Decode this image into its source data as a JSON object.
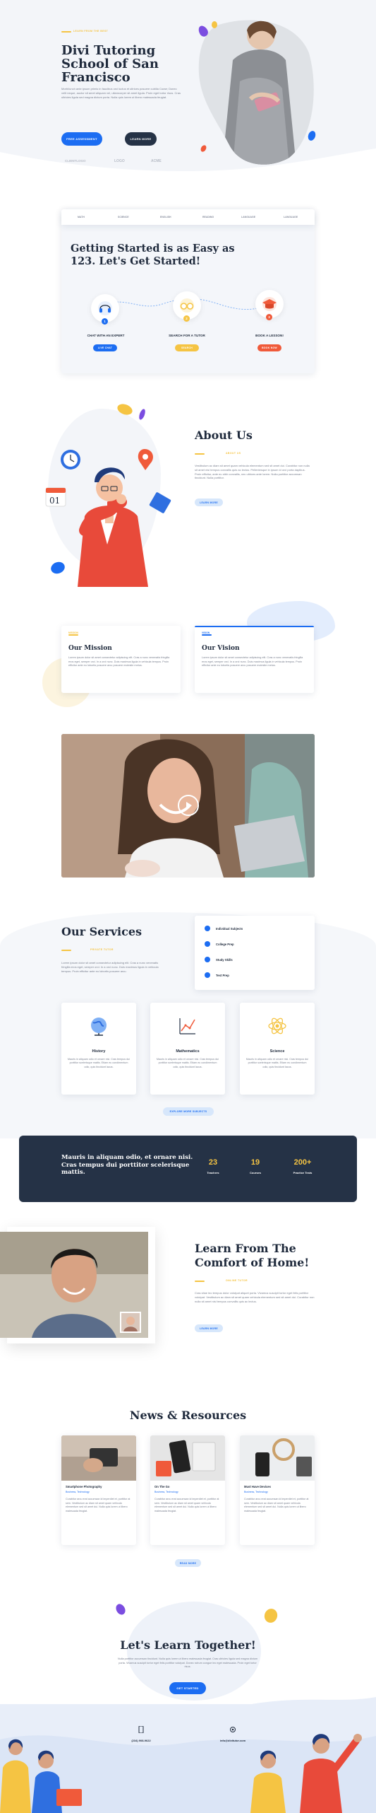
{
  "colors": {
    "blue": "#1c6df2",
    "yellow": "#f5c443",
    "red": "#f05a3a",
    "purple": "#7b4de0",
    "navy": "#253246",
    "bg": "#f3f5f9"
  },
  "hero": {
    "eyebrow": "LEARN FROM THE BEST",
    "title_line1": "Divi Tutoring",
    "title_line2": "School of San",
    "title_line3": "Francisco",
    "text": "Morbi/unch ante ipsum primis in faucibus orci luctus et ultrices posuere cubilia Curae; Donec velit neque, auctor sit amet aliquam vel, ullamcorper sit amet ligula. Proin eget tortor risus. Cras ultricies ligula sed magna dictum porta. Nulla quis lorem ut libero malesuada feugiat.",
    "btn_primary": "FREE ASSESSMENT",
    "btn_secondary": "LEARN MORE",
    "logos": [
      "CLIENTLOGO",
      "LOGO",
      "ACME"
    ]
  },
  "tabs": [
    "MATH",
    "SCIENCE",
    "ENGLISH",
    "READING",
    "LANGUAGE",
    "LANGUAGE"
  ],
  "steps_section": {
    "title_line1": "Getting Started is as Easy as",
    "title_line2": "123. Let's Get Started!",
    "steps": [
      {
        "num": "1",
        "title": "CHAT WITH AN EXPERT",
        "btn": "LIVE CHAT",
        "icon": "headset-icon"
      },
      {
        "num": "2",
        "title": "SEARCH FOR A TUTOR",
        "btn": "SEARCH",
        "icon": "glasses-icon"
      },
      {
        "num": "3",
        "title": "BOOK A LESSON!",
        "btn": "BOOK NOW",
        "icon": "graduation-cap-icon"
      }
    ]
  },
  "about": {
    "title": "About Us",
    "eyebrow": "ABOUT US",
    "text": "Vestibulum ac diam sit amet quam vehicula elementum sed sit amet dui. Curabitur non nulla sit amet nisl tempus convallis quis ac lectus. Pellentesque in ipsum id orci porta dapibus. Proin efficitur, ante eu nibh convallis, nec ultrices ante lorem. Nulla porttitor accumsan tincidunt. Nulla porttitor.",
    "btn": "LEARN MORE",
    "calendar_day": "01"
  },
  "mission": {
    "eyebrow": "MISSION",
    "title": "Our Mission",
    "text": "Lorem ipsum dolor sit amet consectetur adipiscing elit. Cras a nunc venenatis fringilla eros eget, semper orci. In a orci nunc. Duis maximus ligula in vehicula tempus. Proin efficitur ante eu lobortis posuere arcu posuere molestie metus."
  },
  "vision": {
    "eyebrow": "VISION",
    "title": "Our Vision",
    "text": "Lorem ipsum dolor sit amet consectetur adipiscing elit. Cras a nunc venenatis fringilla eros eget, semper orci. In a orci nunc. Duis maximus ligula in vehicula tempus. Proin efficitur ante eu lobortis posuere arcu posuere molestie metus."
  },
  "services": {
    "title": "Our Services",
    "eyebrow": "PRIVATE TUTOR",
    "text": "Lorem ipsum dolor sit amet consectetur adipiscing elit. Cras a nunc venenatis fringilla eros eget, semper orci. In a orci nunc. Duis maximus ligula in vehicula tempus. Proin efficitur ante eu lobortis posuere arcu.",
    "list": [
      "Individual Subjects",
      "College Prep",
      "Study Skills",
      "Test Prep"
    ],
    "cards": [
      {
        "title": "History",
        "text": "Mauris in aliquam odio et ornare nisi. Cras tempus dui porttitor scelerisque mattis. Etiam eu condimentum odio, quis tincidunt lacus.",
        "icon": "globe-icon"
      },
      {
        "title": "Mathematics",
        "text": "Mauris in aliquam odio et ornare nisi. Cras tempus dui porttitor scelerisque mattis. Etiam eu condimentum odio, quis tincidunt lacus.",
        "icon": "chart-icon"
      },
      {
        "title": "Science",
        "text": "Mauris in aliquam odio et ornare nisi. Cras tempus dui porttitor scelerisque mattis. Etiam eu condimentum odio, quis tincidunt lacus.",
        "icon": "atom-icon"
      }
    ],
    "btn": "EXPLORE MORE SUBJECTS"
  },
  "stats": {
    "quote": "Mauris in aliquam odio, et ornare nisi. Cras tempus dui porttitor scelerisque mattis.",
    "items": [
      {
        "value": "23",
        "label": "Teachers"
      },
      {
        "value": "19",
        "label": "Courses"
      },
      {
        "value": "200+",
        "label": "Practice Tests"
      }
    ]
  },
  "learn_home": {
    "title_line1": "Learn From The",
    "title_line2": "Comfort of Home!",
    "eyebrow": "ONLINE TUTOR",
    "text": "Cras vitae leo tempus dolor volutpat aliquet porta. Vivamus suscipit tortor eget felis porttitor volutpat. Vestibulum ac diam sit amet quam vehicula elementum sed sit amet dui. Curabitur non nulla sit amet nisl tempus convallis quis ac lectus.",
    "btn": "LEARN MORE"
  },
  "news": {
    "title": "News & Resources",
    "posts": [
      {
        "title": "Smartphone Photography",
        "category": "Business, Technology",
        "text": "Curabitur arcu erat accumsan id imperdiet et, porttitor at sem. Vestibulum ac diam sit amet quam vehicula elementum sed sit amet dui. Nulla quis lorem ut libero malesuada feugiat."
      },
      {
        "title": "On The Go",
        "category": "Business, Technology",
        "text": "Curabitur arcu erat accumsan id imperdiet et, porttitor at sem. Vestibulum ac diam sit amet quam vehicula elementum sed sit amet dui. Nulla quis lorem ut libero malesuada feugiat."
      },
      {
        "title": "Must Have Devices",
        "category": "Business, Technology",
        "text": "Curabitur arcu erat accumsan id imperdiet et, porttitor at sem. Vestibulum ac diam sit amet quam vehicula elementum sed sit amet dui. Nulla quis lorem ut libero malesuada feugiat."
      }
    ],
    "btn": "READ MORE"
  },
  "cta": {
    "title": "Let's Learn Together!",
    "text": "Nulla porttitor accumsan tincidunt. Nulla quis lorem ut libero malesuada feugiat. Cras ultricies ligula sed magna dictum porta. Vivamus suscipit tortor eget felis porttitor volutpat. Donec rutrum congue leo eget malesuada. Proin eget tortor risus.",
    "btn": "GET STARTED"
  },
  "footer": {
    "phone": "(234) 908-9622",
    "email": "info@divitutor.com"
  }
}
